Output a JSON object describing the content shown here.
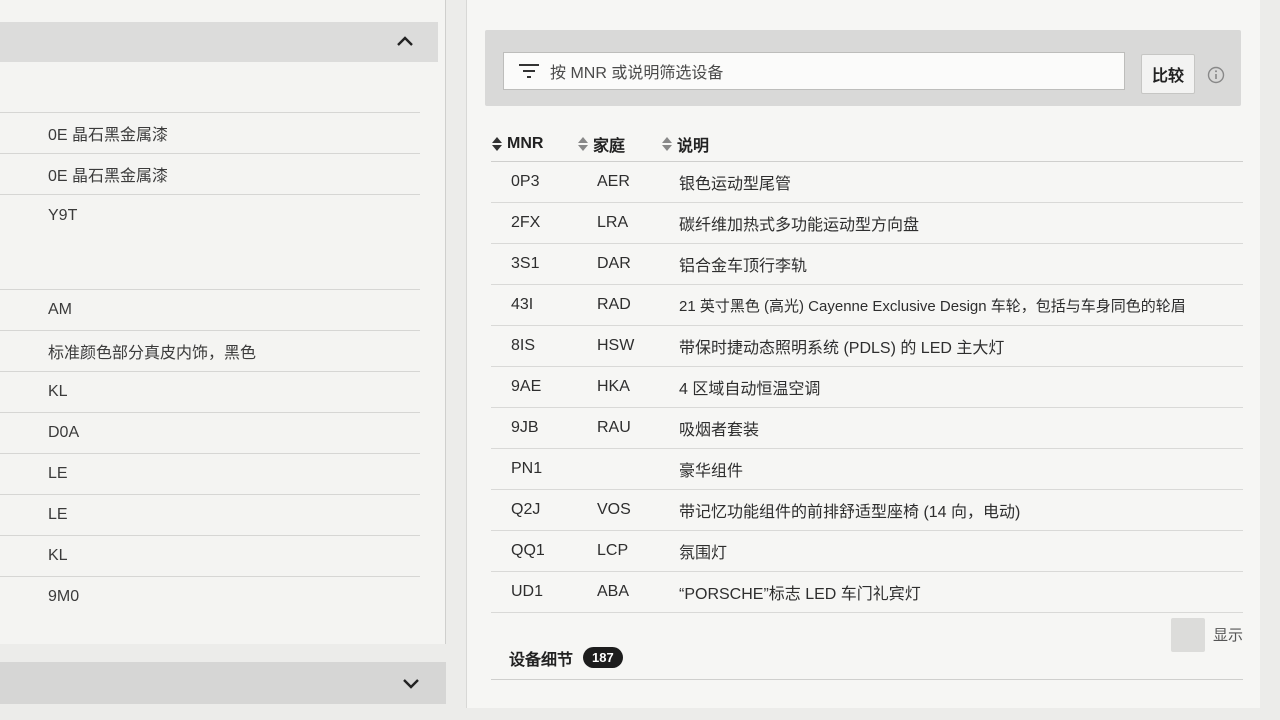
{
  "left": {
    "rows": [
      {
        "label": "0E 晶石黑金属漆"
      },
      {
        "label": "0E 晶石黑金属漆"
      },
      {
        "label": "Y9T"
      },
      {
        "label": "AM"
      },
      {
        "label": "标准颜色部分真皮内饰，黑色"
      },
      {
        "label": "KL"
      },
      {
        "label": "D0A"
      },
      {
        "label": "LE"
      },
      {
        "label": "LE"
      },
      {
        "label": "KL"
      },
      {
        "label": "9M0"
      }
    ],
    "header_icon": "chevron-up-icon",
    "footer_icon": "chevron-down-icon"
  },
  "filter": {
    "placeholder": "按 MNR 或说明筛选设备",
    "compare_label": "比较",
    "filter_icon": "filter-lines-icon",
    "info_icon": "info-icon"
  },
  "table": {
    "headers": {
      "mnr": "MNR",
      "family": "家庭",
      "desc": "说明"
    },
    "rows": [
      {
        "mnr": "0P3",
        "family": "AER",
        "desc": "银色运动型尾管"
      },
      {
        "mnr": "2FX",
        "family": "LRA",
        "desc": "碳纤维加热式多功能运动型方向盘"
      },
      {
        "mnr": "3S1",
        "family": "DAR",
        "desc": "铝合金车顶行李轨"
      },
      {
        "mnr": "43I",
        "family": "RAD",
        "desc": "21 英寸黑色 (高光) Cayenne Exclusive Design 车轮，包括与车身同色的轮眉"
      },
      {
        "mnr": "8IS",
        "family": "HSW",
        "desc": "带保时捷动态照明系统 (PDLS) 的 LED 主大灯"
      },
      {
        "mnr": "9AE",
        "family": "HKA",
        "desc": "4 区域自动恒温空调"
      },
      {
        "mnr": "9JB",
        "family": "RAU",
        "desc": "吸烟者套装"
      },
      {
        "mnr": "PN1",
        "family": "",
        "desc": "豪华组件"
      },
      {
        "mnr": "Q2J",
        "family": "VOS",
        "desc": "带记忆功能组件的前排舒适型座椅 (14 向，电动)"
      },
      {
        "mnr": "QQ1",
        "family": "LCP",
        "desc": "氛围灯"
      },
      {
        "mnr": "UD1",
        "family": "ABA",
        "desc": "“PORSCHE”标志 LED 车门礼宾灯"
      }
    ]
  },
  "details": {
    "label": "设备细节",
    "count": "187",
    "show_label": "显示"
  }
}
